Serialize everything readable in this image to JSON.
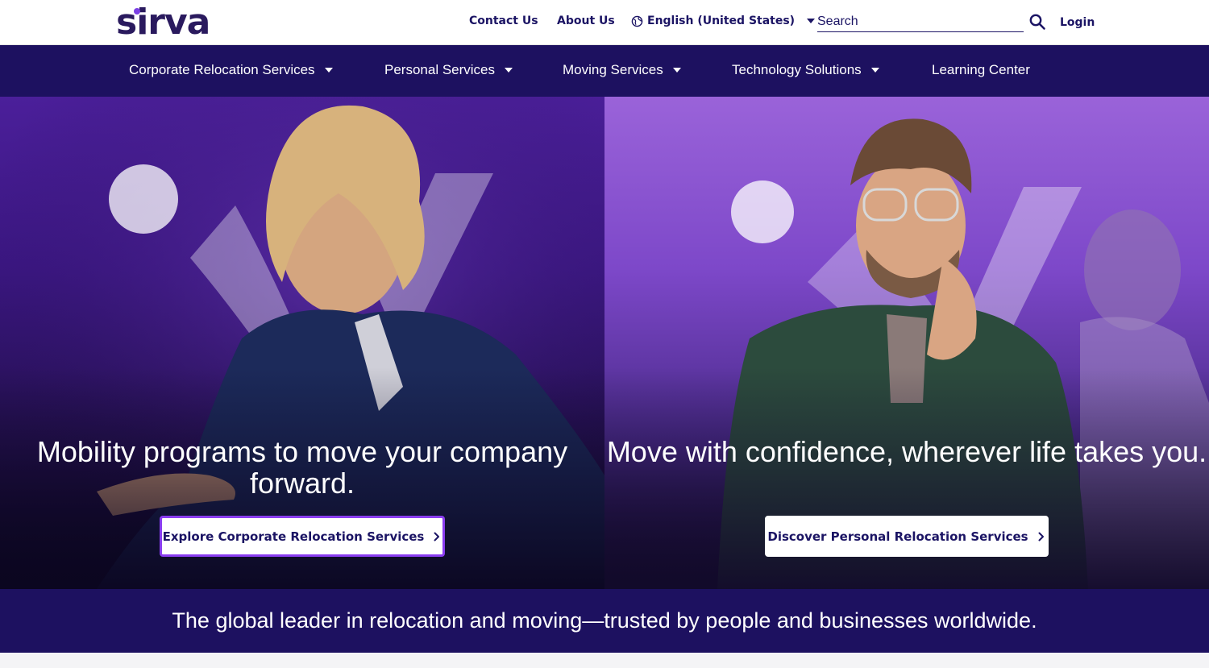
{
  "brand": {
    "logo_text": "sirva",
    "colors": {
      "navy": "#1d1160",
      "link": "#1b1464",
      "accent_purple": "#8a3df0"
    }
  },
  "utility_nav": {
    "contact_label": "Contact Us",
    "about_label": "About Us",
    "language_label": "English (United States)",
    "language_icon": "globe-icon",
    "search_placeholder": "Search",
    "search_icon": "search-icon",
    "login_label": "Login"
  },
  "main_nav": {
    "items": [
      {
        "label": "Corporate Relocation Services",
        "has_dropdown": true
      },
      {
        "label": "Personal Services",
        "has_dropdown": true
      },
      {
        "label": "Moving Services",
        "has_dropdown": true
      },
      {
        "label": "Technology Solutions",
        "has_dropdown": true
      },
      {
        "label": "Learning Center",
        "has_dropdown": false
      }
    ]
  },
  "hero": {
    "left": {
      "heading": "Mobility programs to move your company forward.",
      "cta_label": "Explore Corporate Relocation Services",
      "cta_icon": "chevron-right-icon"
    },
    "right": {
      "heading": "Move with confidence, wherever life takes you.",
      "cta_label": "Discover Personal Relocation Services",
      "cta_icon": "chevron-right-icon"
    }
  },
  "tagline": "The global leader in relocation and moving—trusted by people and businesses worldwide."
}
